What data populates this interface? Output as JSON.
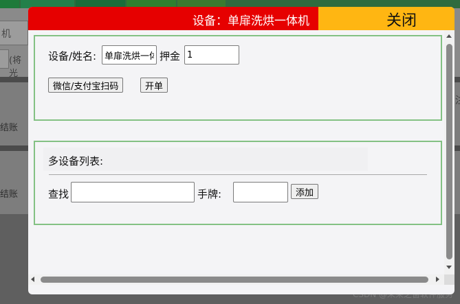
{
  "background": {
    "input_fragment": "机",
    "note_fragment": "(将光",
    "row1_fragment": "结账",
    "row2_fragment": "结账",
    "right_fragment": "注",
    "watermark": "CSDN @未来之窗软件服务"
  },
  "dialog": {
    "title": "设备：单扉洗烘一体机",
    "close_label": "关闭",
    "colors": {
      "title_bg": "#e60000",
      "close_bg": "#ffb612",
      "section_border": "#83c183"
    },
    "section1": {
      "device_label": "设备/姓名:",
      "device_value": "单扉洗烘一体机",
      "deposit_label": "押金",
      "deposit_value": "1",
      "scan_button": "微信/支付宝扫码",
      "open_button": "开单"
    },
    "section2": {
      "title": "多设备列表:",
      "search_label": "查找",
      "search_value": "",
      "tag_label": "手牌:",
      "tag_value": "",
      "add_button": "添加"
    }
  }
}
